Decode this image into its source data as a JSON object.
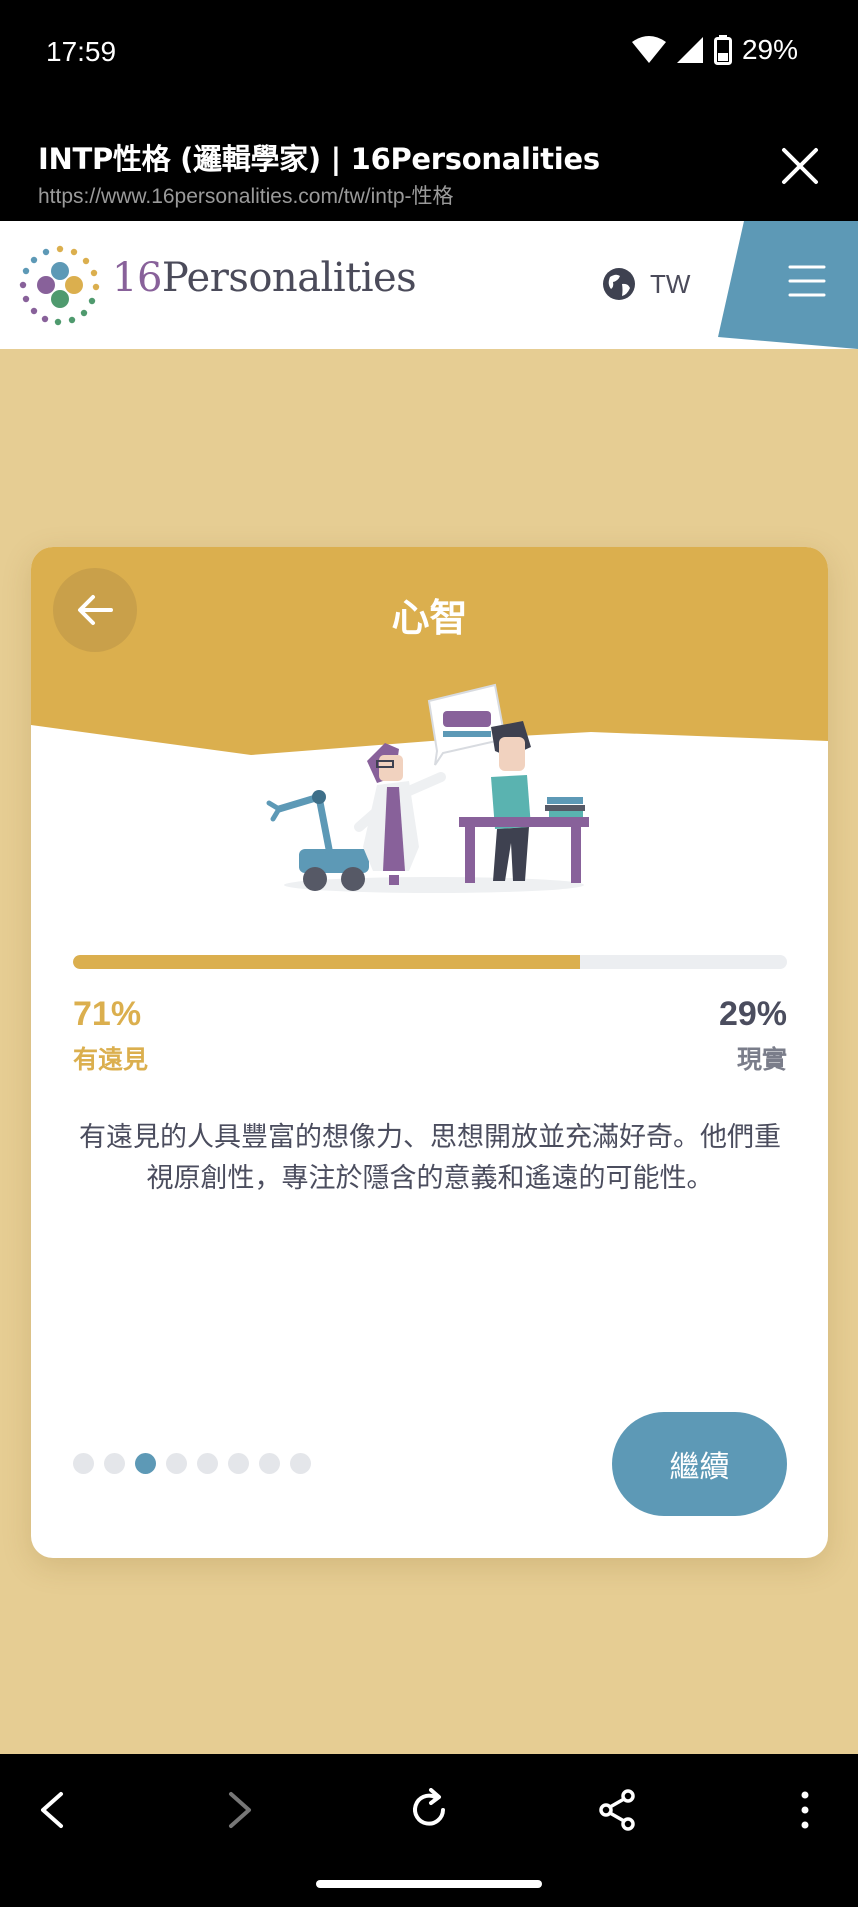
{
  "status_bar": {
    "time": "17:59",
    "battery": "29%",
    "icons": [
      "wifi-icon",
      "signal-icon",
      "battery-icon"
    ]
  },
  "tab": {
    "title": "INTP性格 (邏輯學家) | 16Personalities",
    "url": "https://www.16personalities.com/tw/intp-性格"
  },
  "site_header": {
    "logo_number": "16",
    "logo_word": "Personalities",
    "language": "TW",
    "accent_color": "#5d99b6"
  },
  "card": {
    "title": "心智",
    "progress_left_fraction": 0.71,
    "left": {
      "percent": "71%",
      "label": "有遠見"
    },
    "right": {
      "percent": "29%",
      "label": "現實"
    },
    "description": "有遠見的人具豐富的想像力、思想開放並充滿好奇。他們重視原創性，專注於隱含的意義和遙遠的可能性。",
    "dots_total": 8,
    "dots_active_index": 2,
    "continue_label": "繼續",
    "header_color": "#dbaf4e"
  },
  "nav_bar": {
    "icons": [
      "back-icon",
      "forward-icon",
      "reload-icon",
      "share-icon",
      "more-icon"
    ]
  }
}
